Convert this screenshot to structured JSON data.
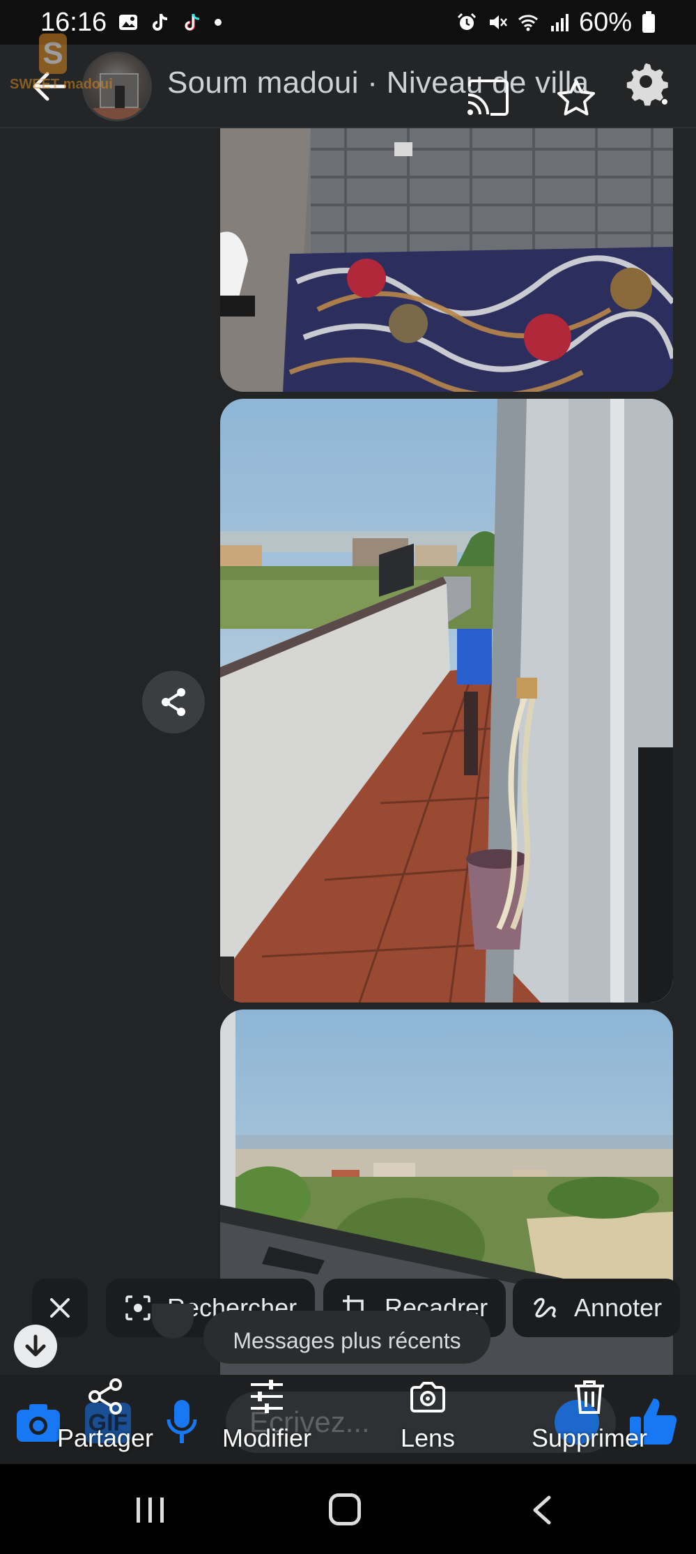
{
  "status_bar": {
    "time": "16:16",
    "battery": "60%"
  },
  "watermark": {
    "logo_letter": "S",
    "text": "SWEET madoui"
  },
  "header": {
    "title": "Soum madoui · Niveau de villa"
  },
  "photos": [
    {
      "label": "bedroom-photo"
    },
    {
      "label": "balcony-photo"
    },
    {
      "label": "view-photo"
    }
  ],
  "chips": {
    "search_label": "Rechercher",
    "crop_label": "Recadrer",
    "annotate_label": "Annoter"
  },
  "newer_messages": "Messages plus récents",
  "composer": {
    "gif_label": "GIF",
    "placeholder": "Écrivez..."
  },
  "actions": {
    "share_label": "Partager",
    "edit_label": "Modifier",
    "lens_label": "Lens",
    "delete_label": "Supprimer"
  },
  "colors": {
    "accent": "#1877f2",
    "background": "#222425",
    "chip_bg": "#1b1c1d"
  }
}
